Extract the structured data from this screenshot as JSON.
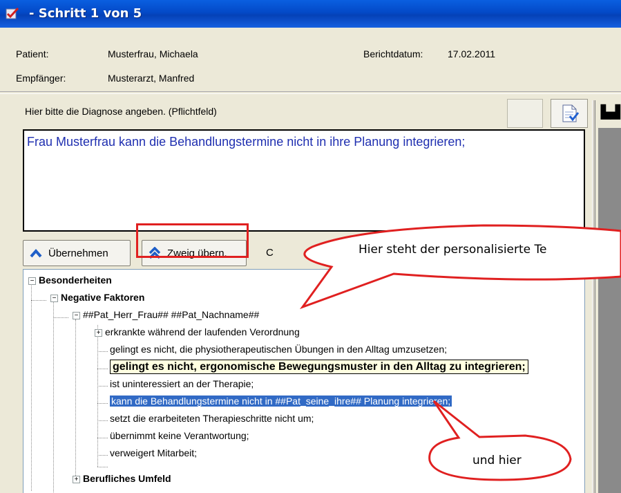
{
  "window": {
    "title": "- Schritt 1 von 5"
  },
  "header": {
    "patient_label": "Patient:",
    "patient_value": "Musterfrau, Michaela",
    "recipient_label": "Empfänger:",
    "recipient_value": "Musterarzt, Manfred",
    "date_label": "Berichtdatum:",
    "date_value": "17.02.2011"
  },
  "form": {
    "prompt": "Hier bitte die Diagnose angeben.   (Pflichtfeld)",
    "diagnosis_text": "Frau Musterfrau kann die Behandlungstermine nicht in ihre Planung integrieren;"
  },
  "toolbar": {
    "adopt_label": "Übernehmen",
    "adopt_branch_label": "Zweig übern.",
    "partial_label": "C"
  },
  "tree": {
    "root": "Besonderheiten",
    "group": "Negative Faktoren",
    "template": "##Pat_Herr_Frau## ##Pat_Nachname##",
    "items": [
      "erkrankte während der laufenden Verordnung",
      "gelingt es nicht, die physiotherapeutischen Übungen in den Alltag umzusetzen;",
      "gelingt es nicht, ergonomische Bewegungsmuster in den Alltag zu integrieren;",
      "ist uninteressiert an der Therapie;",
      "kann die Behandlungstermine nicht in ##Pat_seine_ihre## Planung integrieren;",
      "setzt die erarbeiteten Therapieschritte nicht um;",
      "übernimmt keine Verantwortung;",
      "verweigert Mitarbeit;"
    ],
    "next_group": "Berufliches Umfeld"
  },
  "callouts": {
    "top": "Hier steht der personalisierte Te",
    "bottom": "und hier"
  },
  "colors": {
    "accent": "#e02020",
    "selection": "#316ac5",
    "diagnosis_text": "#1f2fb0"
  }
}
